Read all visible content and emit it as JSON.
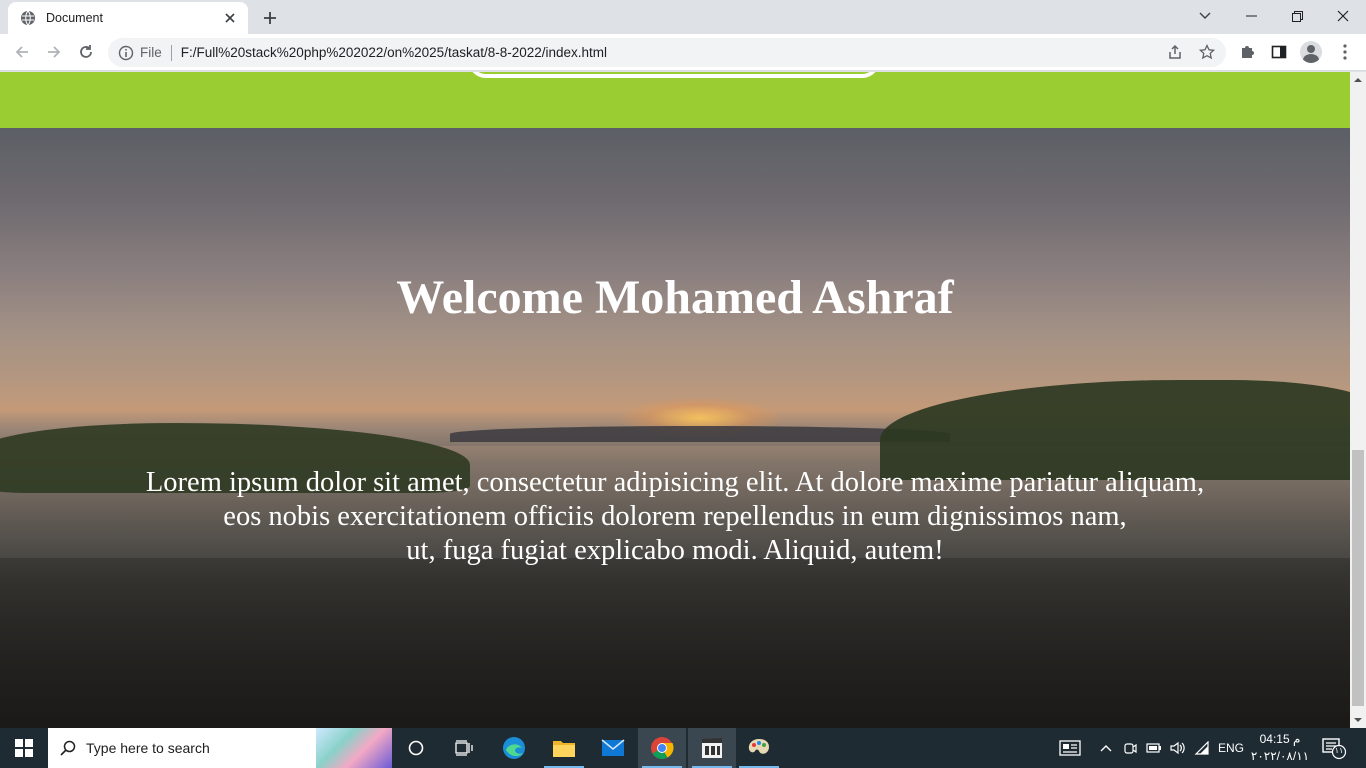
{
  "browser": {
    "tab_title": "Document",
    "url_scheme": "File",
    "url": "F:/Full%20stack%20php%202022/on%2025/taskat/8-8-2022/index.html"
  },
  "page": {
    "heading": "Welcome Mohamed Ashraf",
    "lead_lines": [
      "Lorem ipsum dolor sit amet, consectetur adipisicing elit. At dolore maxime pariatur aliquam,",
      "eos nobis exercitationem officiis dolorem repellendus in eum dignissimos nam,",
      "ut, fuga fugiat explicabo modi. Aliquid, autem!"
    ],
    "colors": {
      "band": "#9acd32",
      "text": "#ffffff"
    }
  },
  "taskbar": {
    "search_placeholder": "Type here to search",
    "language": "ENG",
    "time": "04:15 م",
    "date": "٢٠٢٢/٠٨/١١",
    "notification_count": "١١"
  }
}
